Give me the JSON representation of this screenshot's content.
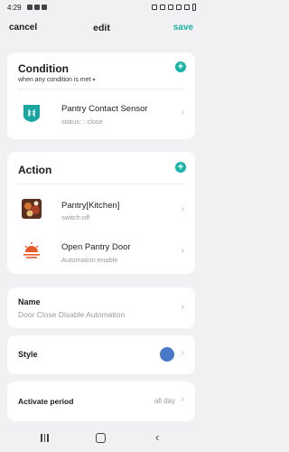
{
  "status_bar": {
    "time": "4:29"
  },
  "header": {
    "cancel": "cancel",
    "title": "edit",
    "save": "save"
  },
  "condition": {
    "title": "Condition",
    "subtitle": "when any condition is met",
    "add": "+",
    "items": [
      {
        "title": "Pantry Contact Sensor",
        "subtitle": "status: : close",
        "icon": "door-sensor-icon"
      }
    ]
  },
  "action": {
    "title": "Action",
    "add": "+",
    "items": [
      {
        "title": "Pantry[Kitchen]",
        "subtitle": "switch:off",
        "icon": "device-photo-icon"
      },
      {
        "title": "Open Pantry Door",
        "subtitle": "Automation:enable",
        "icon": "sunset-icon"
      }
    ]
  },
  "name": {
    "label": "Name",
    "value": "Door Close Disable Automation"
  },
  "style": {
    "label": "Style",
    "color": "#4a78c8"
  },
  "activate_period": {
    "label": "Activate period",
    "value": "all day"
  },
  "colors": {
    "accent": "#19b3a8",
    "background": "#f1f1f3"
  }
}
